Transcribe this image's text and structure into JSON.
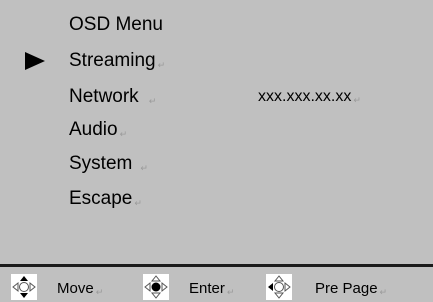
{
  "osd": {
    "title": "OSD Menu",
    "items": [
      {
        "label": "Streaming",
        "value": "",
        "selected": true
      },
      {
        "label": "Network",
        "value": "xxx.xxx.xx.xx",
        "selected": false
      },
      {
        "label": "Audio",
        "value": "",
        "selected": false
      },
      {
        "label": "System",
        "value": "",
        "selected": false
      },
      {
        "label": "Escape",
        "value": "",
        "selected": false
      }
    ]
  },
  "footer": {
    "move_label": "Move",
    "enter_label": "Enter",
    "prepage_label": "Pre Page"
  },
  "icons": {
    "selection": "right-triangle-pointer-icon",
    "move": "dpad-up-down-icon",
    "enter": "dpad-center-icon",
    "prepage": "dpad-left-icon"
  },
  "colors": {
    "panel": "#c0c0c0",
    "text": "#000000",
    "divider": "#1a1a1a"
  }
}
